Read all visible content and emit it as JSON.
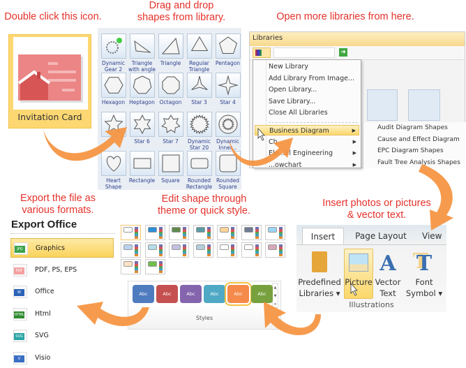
{
  "captions": {
    "double_click": "Double click this icon.",
    "drag_drop": [
      "Drag and drop",
      "shapes from library."
    ],
    "open_more": "Open more libraries from here.",
    "export": [
      "Export the file as",
      "various formats."
    ],
    "edit_shape": [
      "Edit shape through",
      "theme or quick style."
    ],
    "insert": [
      "Insert photos or pictures",
      "& vector text."
    ]
  },
  "template_card": {
    "label": "Invitation Card"
  },
  "shape_library": {
    "shapes": [
      {
        "label": "Dynamic Gear 2",
        "icon": "gear"
      },
      {
        "label": "Triangle with angle",
        "icon": "right-triangle"
      },
      {
        "label": "Triangle",
        "icon": "triangle"
      },
      {
        "label": "Regular Triangle",
        "icon": "regular-triangle"
      },
      {
        "label": "Pentagon",
        "icon": "pentagon"
      },
      {
        "label": "Hexagon",
        "icon": "hexagon"
      },
      {
        "label": "Heptagon",
        "icon": "heptagon"
      },
      {
        "label": "Octagon",
        "icon": "octagon"
      },
      {
        "label": "Star 3",
        "icon": "star3"
      },
      {
        "label": "Star 4",
        "icon": "star4"
      },
      {
        "label": "",
        "icon": "star5"
      },
      {
        "label": "Star 6",
        "icon": "star6"
      },
      {
        "label": "Star 7",
        "icon": "star7"
      },
      {
        "label": "Dynamic Star 20",
        "icon": "star20"
      },
      {
        "label": "Dynamic Inner...",
        "icon": "inner-circle"
      },
      {
        "label": "Heart Shape",
        "icon": "heart"
      },
      {
        "label": "Rectangle",
        "icon": "rectangle"
      },
      {
        "label": "Square",
        "icon": "square"
      },
      {
        "label": "Rounded Rectangle",
        "icon": "rounded-rectangle"
      },
      {
        "label": "Rounded Square",
        "icon": "rounded-square"
      }
    ]
  },
  "libraries": {
    "title": "Libraries",
    "menu": [
      "New Library",
      "Add Library From Image...",
      "Open Library...",
      "Save Library...",
      "Close All Libraries"
    ],
    "categories": [
      "Business Diagram",
      "Ch...",
      "Ele...al Engineering",
      "...owchart"
    ],
    "submenu": [
      "Audit Diagram Shapes",
      "Cause and Effect Diagram",
      "EPC Diagram Shapes",
      "Fault Tree Analysis Shapes"
    ]
  },
  "export": {
    "title": "Export Office",
    "items": [
      {
        "label": "Graphics",
        "badge": "JPG",
        "color": "#3aa24a",
        "selected": true
      },
      {
        "label": "PDF, PS, EPS",
        "badge": "PDF",
        "color": "#f4a0a0"
      },
      {
        "label": "Office",
        "badge": "W",
        "color": "#2b62b8"
      },
      {
        "label": "Html",
        "badge": "HTML",
        "color": "#2e8b2e"
      },
      {
        "label": "SVG",
        "badge": "SVG",
        "color": "#2aa5a5"
      },
      {
        "label": "Visio",
        "badge": "V",
        "color": "#3a6fc4"
      }
    ]
  },
  "styles": {
    "label": "Styles",
    "buttons": [
      {
        "label": "Abc",
        "color": "#4f7bbf"
      },
      {
        "label": "Abc",
        "color": "#c55050"
      },
      {
        "label": "Abc",
        "color": "#8465ad"
      },
      {
        "label": "Abc",
        "color": "#4fa9c4"
      },
      {
        "label": "Abc",
        "color": "#f58a4b",
        "selected": true
      },
      {
        "label": "Abc",
        "color": "#77a13e"
      }
    ],
    "theme_colors": [
      "#ffffff",
      "#2d8fd8",
      "#5f8a4d",
      "#5b9ba4",
      "#fbd49a",
      "#707b94",
      "#9ad6f3",
      "#b9d3ee",
      "#b5dcea",
      "#c2bfe2",
      "#b3cfd9",
      "#ffffff",
      "#ffffff",
      "#d6a9b9",
      "#fde2c5",
      "#6cc04a"
    ]
  },
  "ribbon": {
    "tabs": [
      "Insert",
      "Page Layout",
      "View"
    ],
    "buttons": [
      [
        "Predefined",
        "Libraries ▾"
      ],
      [
        "Picture",
        ""
      ],
      [
        "Vector",
        "Text"
      ],
      [
        "Font",
        "Symbol ▾"
      ]
    ],
    "group": "Illustrations"
  },
  "colors": {
    "caption": "#e4322b",
    "arrow": "#f5923e",
    "highlight": "#fdd872"
  }
}
